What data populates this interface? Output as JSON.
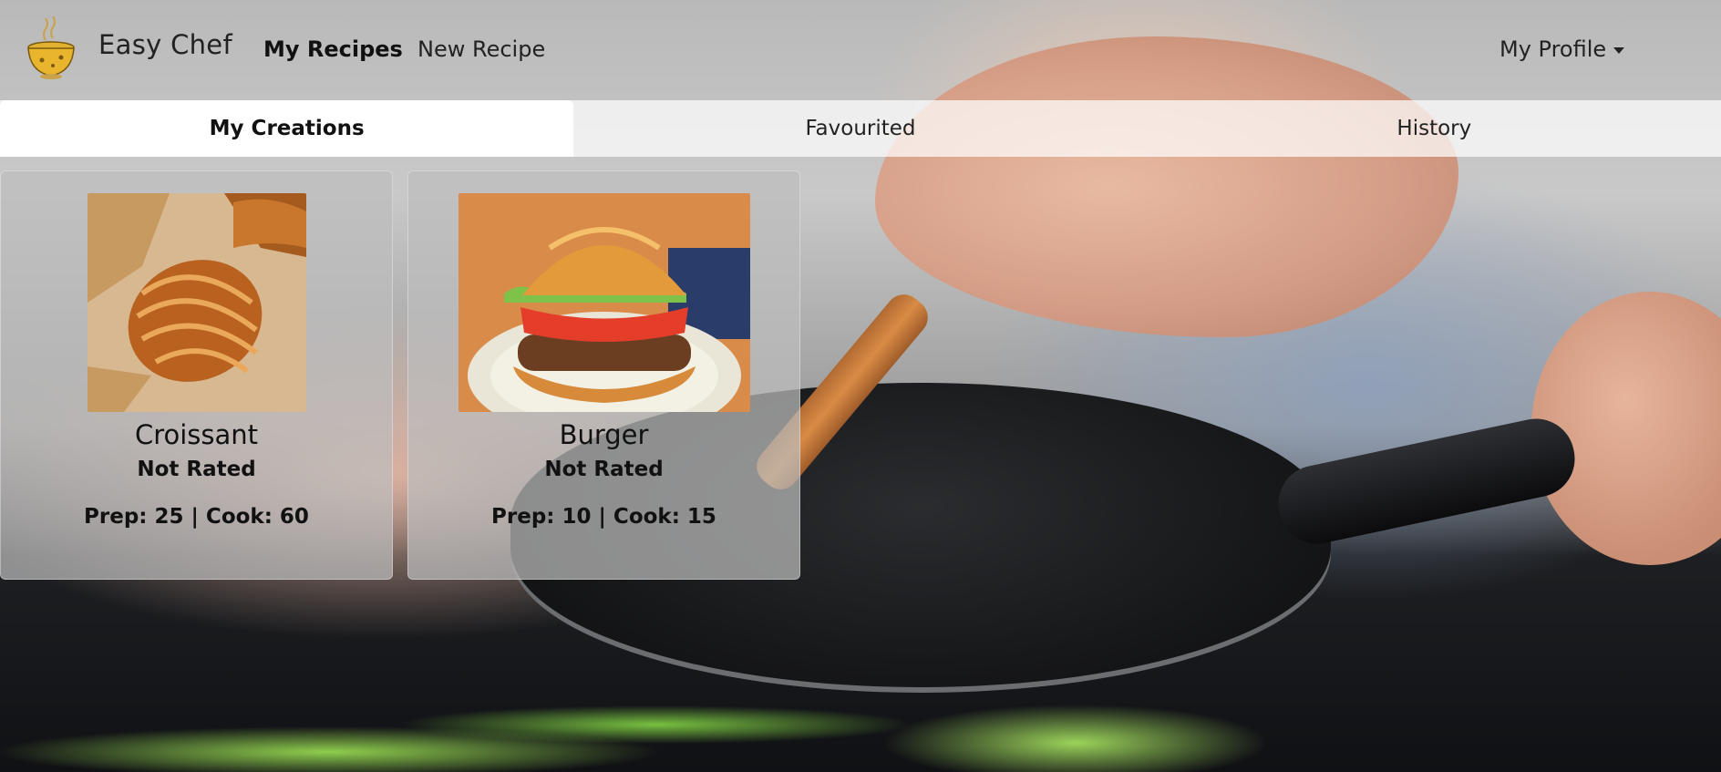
{
  "brand": {
    "name": "Easy Chef"
  },
  "nav": {
    "my_recipes": "My Recipes",
    "new_recipe": "New Recipe",
    "profile": "My Profile"
  },
  "tabs": [
    {
      "label": "My Creations",
      "active": true
    },
    {
      "label": "Favourited",
      "active": false
    },
    {
      "label": "History",
      "active": false
    }
  ],
  "recipes": [
    {
      "title": "Croissant",
      "rating": "Not Rated",
      "times": "Prep: 25 | Cook: 60"
    },
    {
      "title": "Burger",
      "rating": "Not Rated",
      "times": "Prep: 10 | Cook: 15"
    }
  ],
  "icons": {
    "logo": "soup-bowl-logo",
    "profile_caret": "caret-down-icon"
  }
}
